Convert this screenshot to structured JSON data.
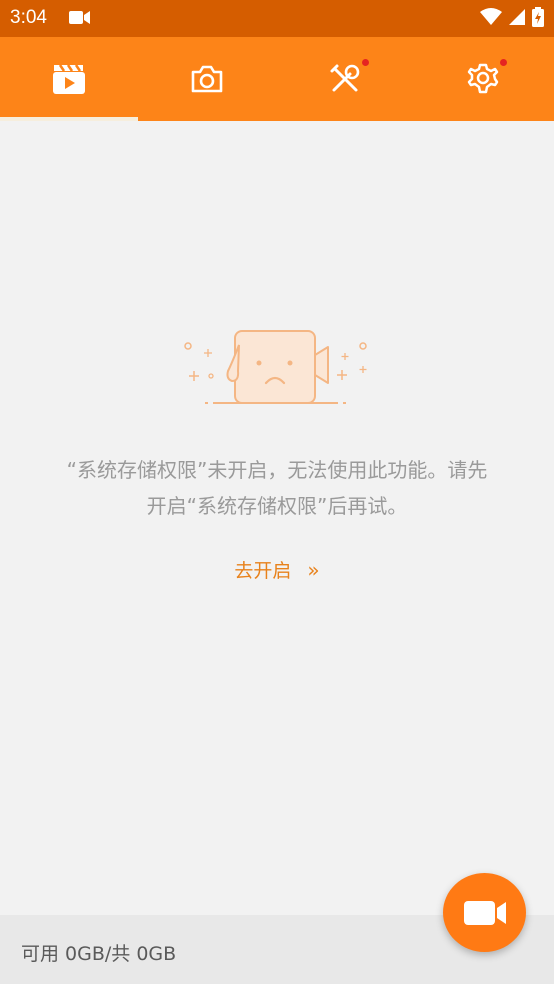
{
  "status": {
    "time": "3:04"
  },
  "tabs": [
    {
      "name": "videos",
      "icon": "film-clapper-icon",
      "selected": true,
      "badge": false
    },
    {
      "name": "screenshots",
      "icon": "camera-icon",
      "selected": false,
      "badge": false
    },
    {
      "name": "tools",
      "icon": "tools-icon",
      "selected": false,
      "badge": true
    },
    {
      "name": "settings",
      "icon": "gear-icon",
      "selected": false,
      "badge": true
    }
  ],
  "empty_state": {
    "message_line1": "“系统存储权限”未开启，无法使用此功能。请先",
    "message_line2": "开启“系统存储权限”后再试。",
    "action_label": "去开启",
    "action_chevron": "»"
  },
  "storage": {
    "text": "可用 0GB/共 0GB"
  },
  "colors": {
    "status_bar": "#d55d00",
    "tab_bar": "#fd8418",
    "accent": "#e8821c",
    "fab": "#ff7a14",
    "badge": "#e52421"
  }
}
